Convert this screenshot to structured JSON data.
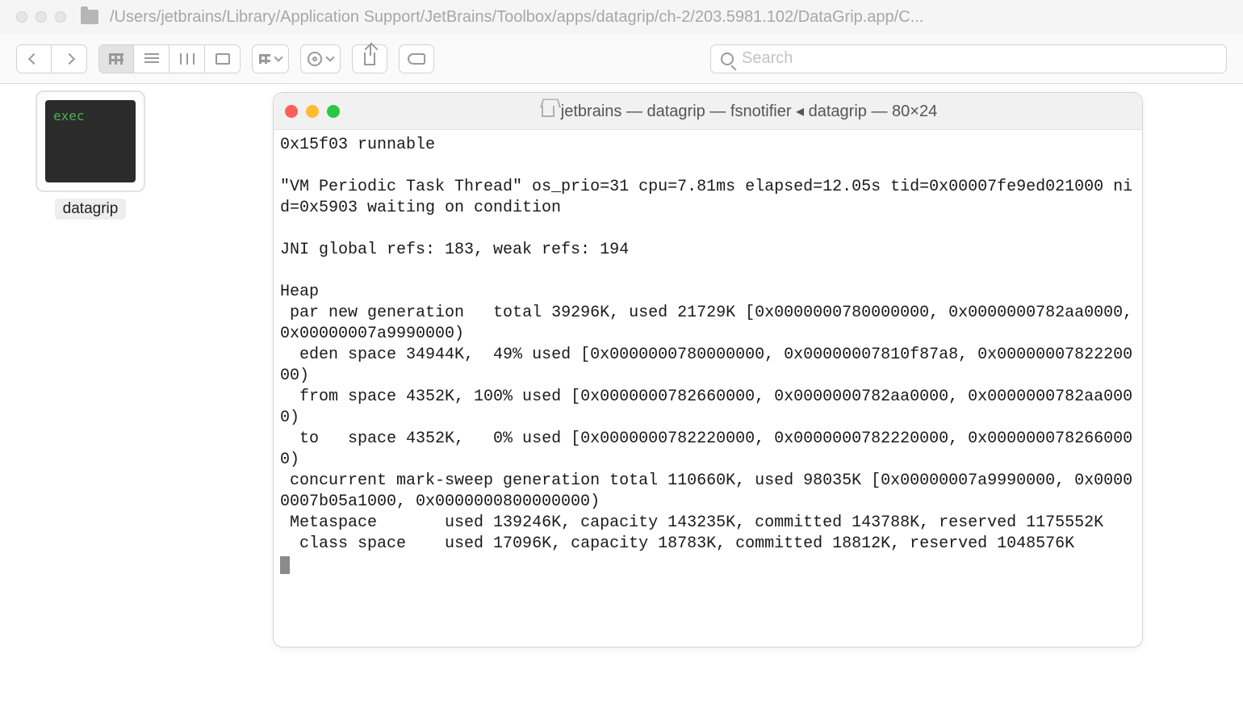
{
  "finder": {
    "path": "/Users/jetbrains/Library/Application Support/JetBrains/Toolbox/apps/datagrip/ch-2/203.5981.102/DataGrip.app/C...",
    "search_placeholder": "Search",
    "file": {
      "name": "datagrip",
      "exec_label": "exec"
    }
  },
  "terminal": {
    "title": "jetbrains — datagrip — fsnotifier ◂ datagrip — 80×24",
    "output": "0x15f03 runnable\n\n\"VM Periodic Task Thread\" os_prio=31 cpu=7.81ms elapsed=12.05s tid=0x00007fe9ed021000 nid=0x5903 waiting on condition\n\nJNI global refs: 183, weak refs: 194\n\nHeap\n par new generation   total 39296K, used 21729K [0x0000000780000000, 0x0000000782aa0000, 0x00000007a9990000)\n  eden space 34944K,  49% used [0x0000000780000000, 0x00000007810f87a8, 0x0000000782220000)\n  from space 4352K, 100% used [0x0000000782660000, 0x0000000782aa0000, 0x0000000782aa0000)\n  to   space 4352K,   0% used [0x0000000782220000, 0x0000000782220000, 0x0000000782660000)\n concurrent mark-sweep generation total 110660K, used 98035K [0x00000007a9990000, 0x00000007b05a1000, 0x0000000800000000)\n Metaspace       used 139246K, capacity 143235K, committed 143788K, reserved 1175552K\n  class space    used 17096K, capacity 18783K, committed 18812K, reserved 1048576K\n"
  }
}
